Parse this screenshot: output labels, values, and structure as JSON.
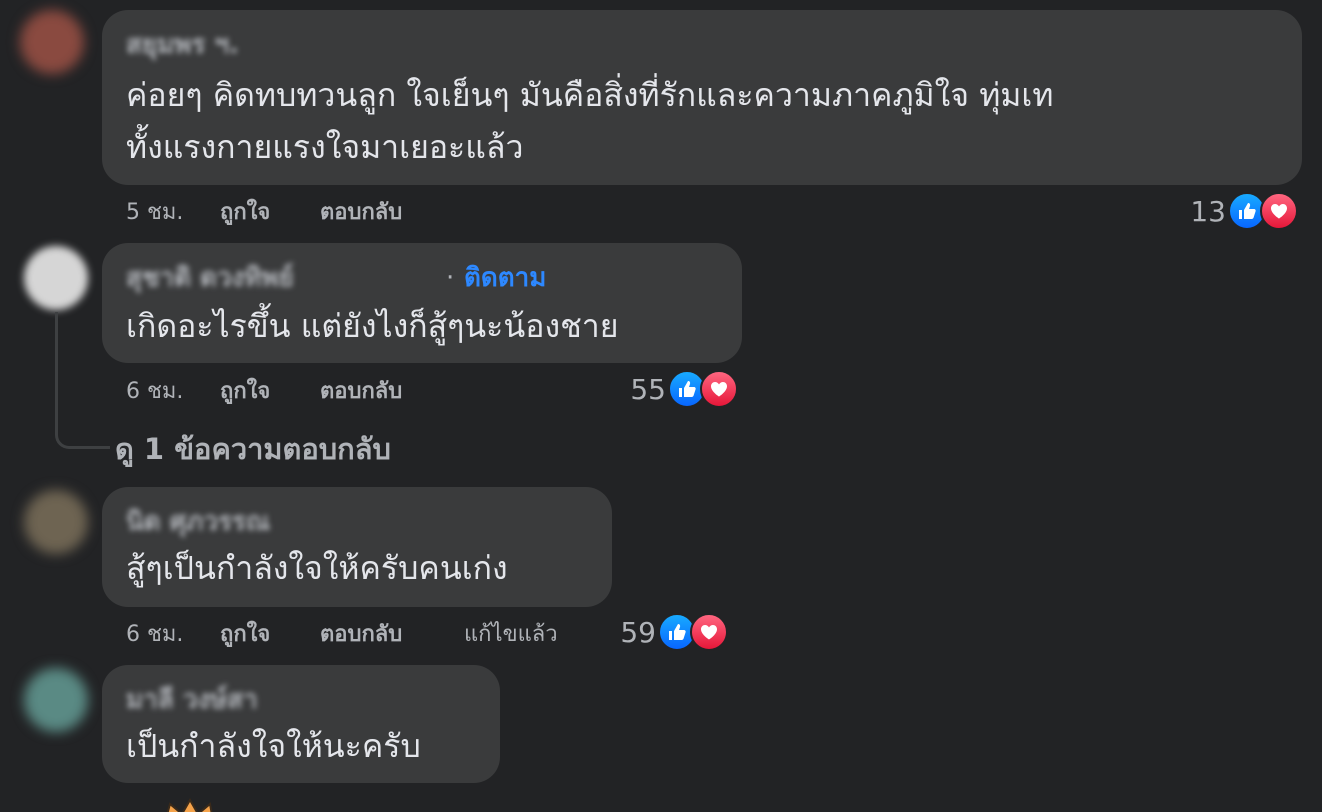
{
  "comments": [
    {
      "author": "สยุมพร ฯ.",
      "lines": [
        "ค่อยๆ คิดทบทวนลูก ใจเย็นๆ มันคือสิ่งที่รักและความภาคภูมิใจ ทุ่มเท",
        "ทั้งแรงกายแรงใจมาเยอะแล้ว"
      ],
      "time": "5 ชม.",
      "like_label": "ถูกใจ",
      "reply_label": "ตอบกลับ",
      "reaction_count": "13"
    },
    {
      "author": "สุชาติ ดวงทิพย์",
      "follow_label": "ติดตาม",
      "dot": "·",
      "lines": [
        "เกิดอะไรขึ้น แต่ยังไงก็สู้ๆนะน้องชาย"
      ],
      "time": "6 ชม.",
      "like_label": "ถูกใจ",
      "reply_label": "ตอบกลับ",
      "reaction_count": "55",
      "view_replies": "ดู 1 ข้อความตอบกลับ"
    },
    {
      "author": "นิด ศุภวรรณ",
      "lines": [
        "สู้ๆเป็นกำลังใจให้ครับคนเก่ง"
      ],
      "time": "6 ชม.",
      "like_label": "ถูกใจ",
      "reply_label": "ตอบกลับ",
      "edited_label": "แก้ไขแล้ว",
      "reaction_count": "59"
    },
    {
      "author": "มาลี วงษ์สา",
      "lines": [
        "เป็นกำลังใจให้นะครับ"
      ]
    }
  ],
  "icons": {
    "like": "thumbs-up-icon",
    "love": "heart-icon"
  },
  "colors": {
    "background": "#222325",
    "bubble": "#3a3b3c",
    "like": "#0866ff",
    "love": "#e61739",
    "follow": "#2d88ff"
  }
}
